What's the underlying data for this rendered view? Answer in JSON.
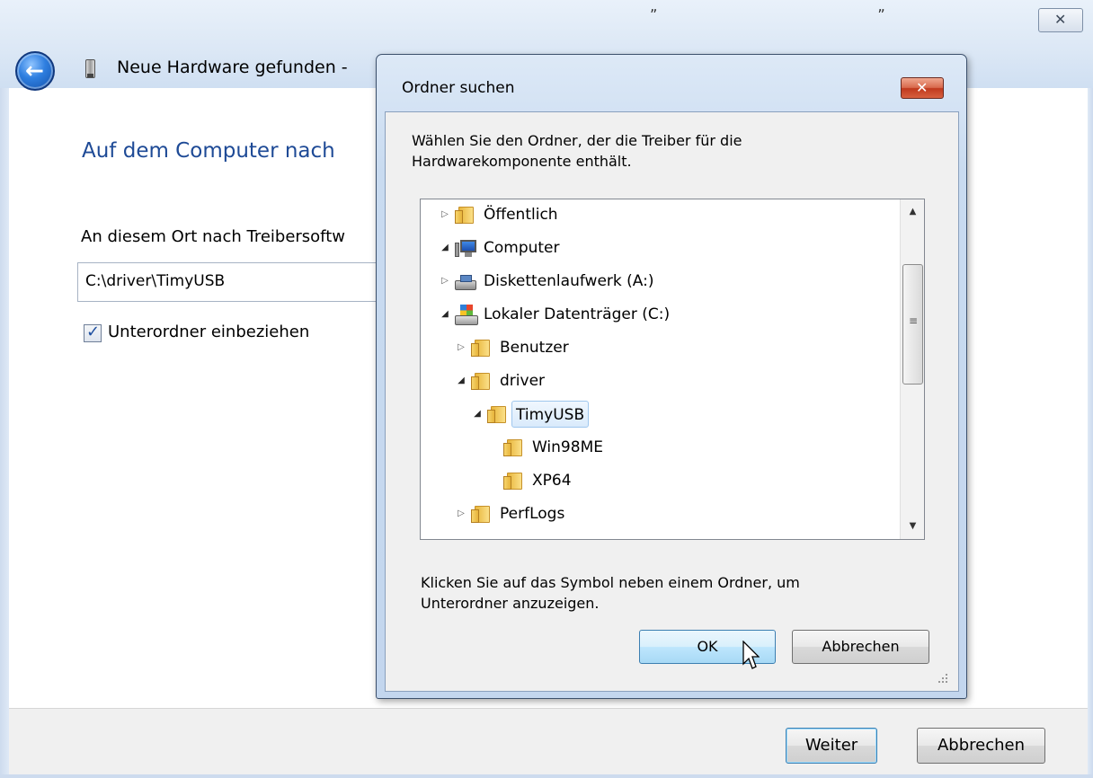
{
  "wizard": {
    "title_fragment": "„ „",
    "title": "Neue Hardware gefunden -",
    "heading": "Auf dem Computer nach",
    "location_label": "An diesem Ort nach Treibersoftw",
    "path_value": "C:\\driver\\TimyUSB",
    "subfolder_label": "Unterordner einbeziehen",
    "subfolder_checked": true,
    "close_glyph": "✕",
    "back_glyph": "←",
    "buttons": {
      "next": "Weiter",
      "cancel": "Abbrechen"
    }
  },
  "dialog": {
    "title": "Ordner suchen",
    "close_glyph": "✕",
    "instruction": "Wählen Sie den Ordner, der die Treiber für die Hardwarekomponente enthält.",
    "tree": [
      {
        "label": "Öffentlich",
        "toggle": "▷",
        "icon": "folder-icon",
        "level": 0
      },
      {
        "label": "Computer",
        "toggle": "◢",
        "icon": "computer-icon",
        "level": 0
      },
      {
        "label": "Diskettenlaufwerk (A:)",
        "toggle": "▷",
        "icon": "floppy-drive-icon",
        "level": 1
      },
      {
        "label": "Lokaler Datenträger (C:)",
        "toggle": "◢",
        "icon": "hard-drive-icon",
        "level": 1
      },
      {
        "label": "Benutzer",
        "toggle": "▷",
        "icon": "folder-icon",
        "level": 2
      },
      {
        "label": "driver",
        "toggle": "◢",
        "icon": "folder-icon",
        "level": 2
      },
      {
        "label": "TimyUSB",
        "toggle": "◢",
        "icon": "folder-icon",
        "level": 3,
        "selected": true
      },
      {
        "label": "Win98ME",
        "toggle": "",
        "icon": "folder-icon",
        "level": 4
      },
      {
        "label": "XP64",
        "toggle": "",
        "icon": "folder-icon",
        "level": 4
      },
      {
        "label": "PerfLogs",
        "toggle": "▷",
        "icon": "folder-icon",
        "level": 2
      }
    ],
    "scroll_up_glyph": "▲",
    "scroll_down_glyph": "▼",
    "scroll_grip_glyph": "≡",
    "hint": "Klicken Sie auf das Symbol neben einem Ordner, um Unterordner anzuzeigen.",
    "buttons": {
      "ok": "OK",
      "cancel": "Abbrechen"
    }
  }
}
